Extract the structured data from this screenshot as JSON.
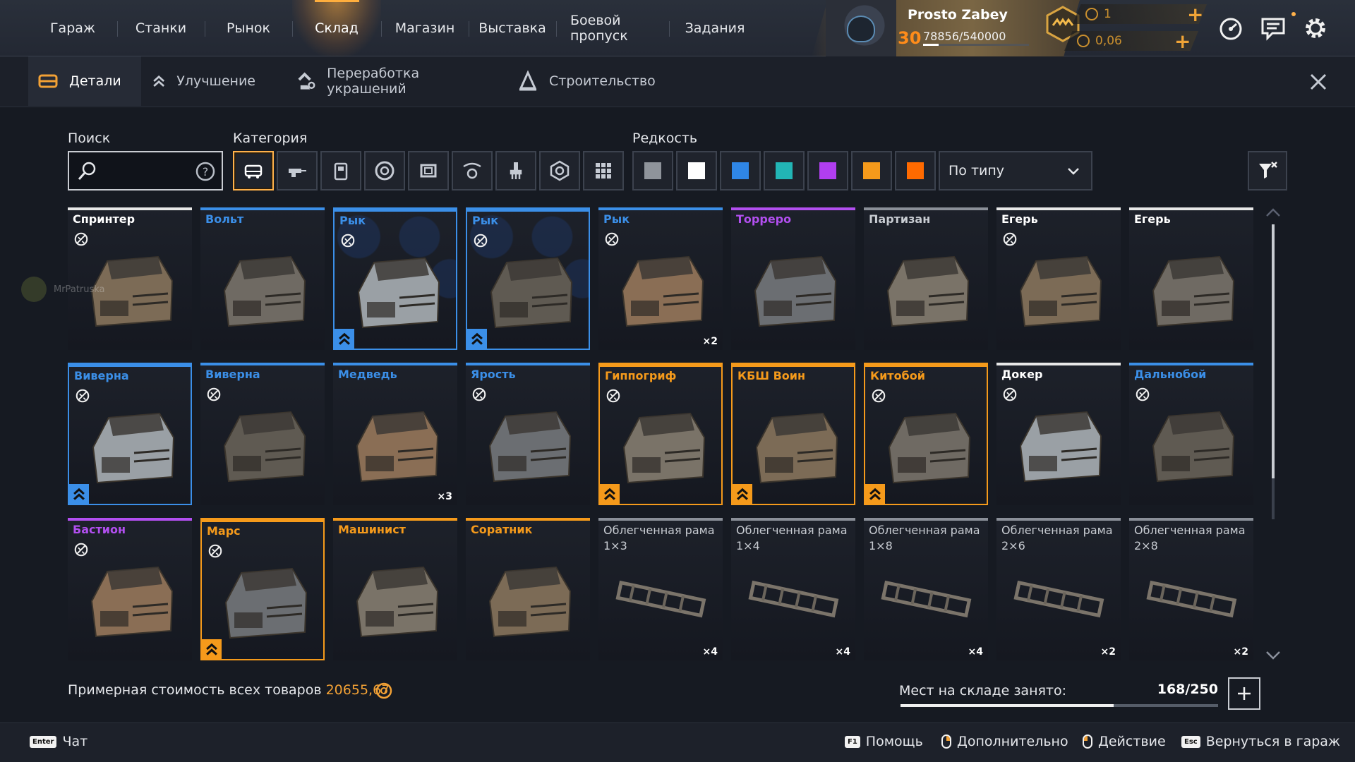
{
  "nav": {
    "items": [
      "Гараж",
      "Станки",
      "Рынок",
      "Склад",
      "Магазин",
      "Выставка",
      "Боевой пропуск",
      "Задания"
    ],
    "active_index": 3
  },
  "profile": {
    "username": "Prosto Zabey",
    "level": "30",
    "xp": "78856/540000",
    "xp_progress": 0.146,
    "currency1": "1",
    "currency2": "0,06"
  },
  "subtabs": [
    {
      "label": "Детали",
      "icon": "parts-icon",
      "active": true
    },
    {
      "label": "Улучшение",
      "icon": "upgrade-chevrons-icon",
      "active": false
    },
    {
      "label": "Переработка украшений",
      "icon": "recycle-decor-icon",
      "active": false
    },
    {
      "label": "Строительство",
      "icon": "construction-icon",
      "active": false
    }
  ],
  "filters": {
    "search_label": "Поиск",
    "category_label": "Категория",
    "rarity_label": "Редкость",
    "categories": [
      "cabin-icon",
      "weapon-icon",
      "module-icon",
      "wheel-icon",
      "frame-icon",
      "movement-icon",
      "decor-icon",
      "structure-icon",
      "other-grid-icon"
    ],
    "active_category": 0,
    "rarity_colors": [
      "#8f949b",
      "#ffffff",
      "#2f86e6",
      "#22b5b5",
      "#b13ef0",
      "#f59a1b",
      "#ff6a00"
    ],
    "sort_value": "По типу"
  },
  "rarity": {
    "common": "#e8e8e8",
    "rare": "#3b8fe8",
    "epic": "#b24ff0",
    "special": "#8a8f98",
    "legendary": "#f59a1b"
  },
  "items": [
    {
      "name": "Спринтер",
      "rarity": "common",
      "lock": true,
      "qty": "",
      "upgrade": false,
      "selected": false
    },
    {
      "name": "Вольт",
      "rarity": "rare",
      "lock": false,
      "qty": "",
      "upgrade": false,
      "selected": false
    },
    {
      "name": "Рык",
      "rarity": "rare",
      "lock": true,
      "qty": "",
      "upgrade": true,
      "selected": true
    },
    {
      "name": "Рык",
      "rarity": "rare",
      "lock": true,
      "qty": "",
      "upgrade": true,
      "selected": true
    },
    {
      "name": "Рык",
      "rarity": "rare",
      "lock": true,
      "qty": "×2",
      "upgrade": false,
      "selected": false
    },
    {
      "name": "Торреро",
      "rarity": "epic",
      "lock": false,
      "qty": "",
      "upgrade": false,
      "selected": false
    },
    {
      "name": "Партизан",
      "rarity": "special",
      "lock": false,
      "qty": "",
      "upgrade": false,
      "selected": false
    },
    {
      "name": "Егерь",
      "rarity": "common",
      "lock": true,
      "qty": "",
      "upgrade": false,
      "selected": false
    },
    {
      "name": "Егерь",
      "rarity": "common",
      "lock": false,
      "qty": "",
      "upgrade": false,
      "selected": false
    },
    {
      "name": "Виверна",
      "rarity": "rare",
      "lock": true,
      "qty": "",
      "upgrade": true,
      "selected": true
    },
    {
      "name": "Виверна",
      "rarity": "rare",
      "lock": true,
      "qty": "",
      "upgrade": false,
      "selected": false
    },
    {
      "name": "Медведь",
      "rarity": "rare",
      "lock": false,
      "qty": "×3",
      "upgrade": false,
      "selected": false
    },
    {
      "name": "Ярость",
      "rarity": "rare",
      "lock": true,
      "qty": "",
      "upgrade": false,
      "selected": false
    },
    {
      "name": "Гиппогриф",
      "rarity": "legendary",
      "lock": true,
      "qty": "",
      "upgrade": true,
      "selected": true
    },
    {
      "name": "КБШ Воин",
      "rarity": "legendary",
      "lock": false,
      "qty": "",
      "upgrade": true,
      "selected": true
    },
    {
      "name": "Китобой",
      "rarity": "legendary",
      "lock": true,
      "qty": "",
      "upgrade": true,
      "selected": true
    },
    {
      "name": "Докер",
      "rarity": "common",
      "lock": true,
      "qty": "",
      "upgrade": false,
      "selected": false
    },
    {
      "name": "Дальнобой",
      "rarity": "rare",
      "lock": true,
      "qty": "",
      "upgrade": false,
      "selected": false
    },
    {
      "name": "Бастион",
      "rarity": "epic",
      "lock": true,
      "qty": "",
      "upgrade": false,
      "selected": false
    },
    {
      "name": "Марс",
      "rarity": "legendary",
      "lock": true,
      "qty": "",
      "upgrade": true,
      "selected": true
    },
    {
      "name": "Машинист",
      "rarity": "legendary",
      "lock": false,
      "qty": "",
      "upgrade": false,
      "selected": false
    },
    {
      "name": "Соратник",
      "rarity": "legendary",
      "lock": false,
      "qty": "",
      "upgrade": false,
      "selected": false
    },
    {
      "name": "Облегченная рама",
      "sub": "1×3",
      "rarity": "special",
      "lock": false,
      "qty": "×4",
      "upgrade": false,
      "selected": false
    },
    {
      "name": "Облегченная рама",
      "sub": "1×4",
      "rarity": "special",
      "lock": false,
      "qty": "×4",
      "upgrade": false,
      "selected": false
    },
    {
      "name": "Облегченная рама",
      "sub": "1×8",
      "rarity": "special",
      "lock": false,
      "qty": "×4",
      "upgrade": false,
      "selected": false
    },
    {
      "name": "Облегченная рама",
      "sub": "2×6",
      "rarity": "special",
      "lock": false,
      "qty": "×2",
      "upgrade": false,
      "selected": false
    },
    {
      "name": "Облегченная рама",
      "sub": "2×8",
      "rarity": "special",
      "lock": false,
      "qty": "×2",
      "upgrade": false,
      "selected": false
    }
  ],
  "ghost_user": "MrPatruska",
  "footer": {
    "estimate_label": "Примерная стоимость всех товаров",
    "estimate_value": "20655,67",
    "storage_label": "Мест на складе занято:",
    "storage_value": "168/250",
    "storage_progress": 0.672
  },
  "hints": {
    "chat_key": "Enter",
    "chat": "Чат",
    "help_key": "F1",
    "help": "Помощь",
    "more": "Дополнительно",
    "action": "Действие",
    "back_key": "Esc",
    "back": "Вернуться в гараж"
  }
}
